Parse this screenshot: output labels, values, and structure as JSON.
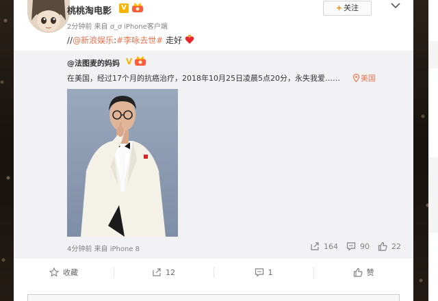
{
  "post": {
    "author": "桃桃淘电影",
    "vip_badge": "V",
    "meta": "2分钟前 来自 ơ_ơ iPhone客户端",
    "follow_label": "关注",
    "text_prefix": "//",
    "mention": "@新浪娱乐",
    "colon": ":",
    "hashtag": "#李咏去世#",
    "text_suffix": " 走好"
  },
  "repost": {
    "author": "@法图麦的妈妈",
    "verified": "V",
    "text": "在美国，经过17个月的抗癌治疗，2018年10月25日凌晨5点20分，永失我爱……",
    "location": "美国",
    "meta": "4分钟前 来自 iPhone 8",
    "stats": {
      "forward": "164",
      "comment": "90",
      "like": "22"
    }
  },
  "actions": {
    "favorite": "收藏",
    "forward": "12",
    "comment": "1",
    "like": "赞"
  },
  "colors": {
    "accent": "#eb7350",
    "orange": "#ff8200",
    "badge_gold": "#f7b500",
    "repost_bg": "#f2f2f5"
  },
  "icons": [
    "avatar",
    "vip-badge-icon",
    "crown-icon",
    "plus-icon",
    "chevron-down-icon",
    "heart-emoji-icon",
    "location-pin-icon",
    "forward-icon",
    "comment-icon",
    "like-icon",
    "star-icon"
  ]
}
